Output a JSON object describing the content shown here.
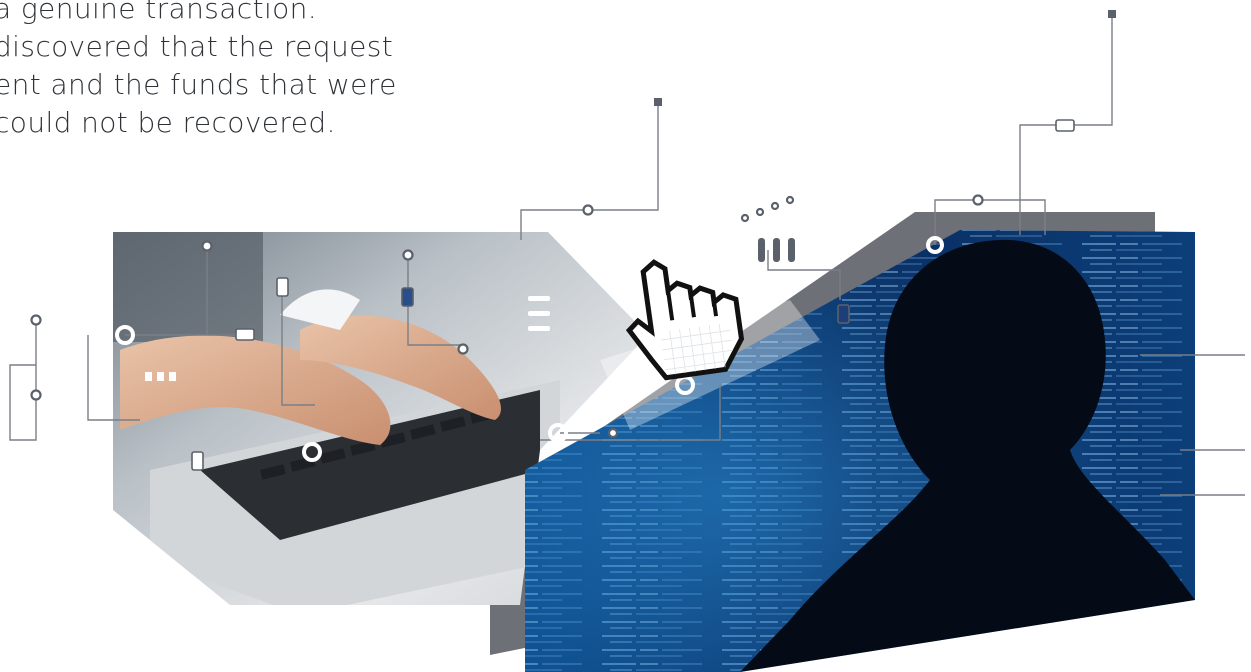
{
  "caption": {
    "lines": [
      "a genuine transaction.",
      "discovered that the request",
      "ent and the funds that were",
      "could not be recovered."
    ]
  },
  "colors": {
    "text": "#2f3338",
    "circuit_line": "#7a7f86",
    "node_dark": "#5b616a",
    "panel_gray": "#6d7077",
    "code_blue": "#0d3a78",
    "code_dark": "#061a3d",
    "silhouette": "#050b16"
  },
  "icons": [
    "hand-pointer-cursor-icon"
  ]
}
